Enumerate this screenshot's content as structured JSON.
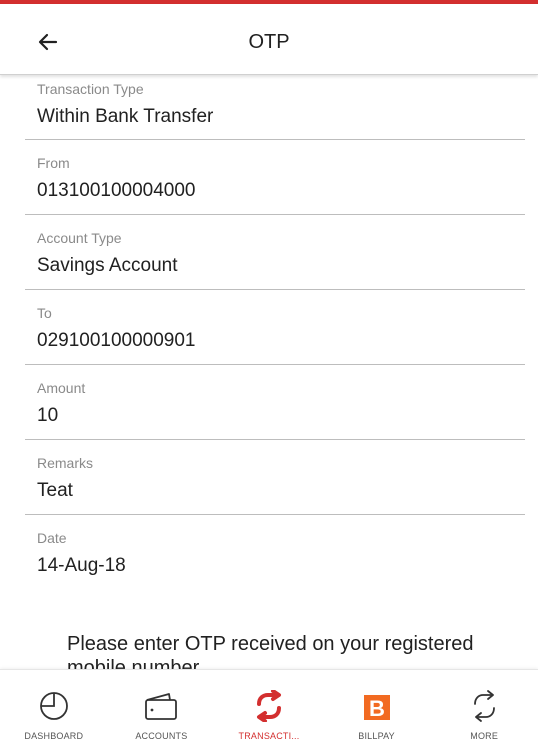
{
  "header": {
    "title": "OTP",
    "back_icon": "arrow-left-icon"
  },
  "details": [
    {
      "label": "Transaction Type",
      "value": "Within Bank Transfer"
    },
    {
      "label": "From",
      "value": "013100100004000"
    },
    {
      "label": "Account Type",
      "value": "Savings Account"
    },
    {
      "label": "To",
      "value": "029100100000901"
    },
    {
      "label": "Amount",
      "value": "10"
    },
    {
      "label": "Remarks",
      "value": "Teat"
    },
    {
      "label": "Date",
      "value": "14-Aug-18"
    }
  ],
  "otp_prompt": "Please enter OTP received on your registered mobile number",
  "bottom_nav": {
    "items": [
      {
        "label": "DASHBOARD",
        "icon": "dashboard-icon",
        "active": false
      },
      {
        "label": "ACCOUNTS",
        "icon": "wallet-icon",
        "active": false
      },
      {
        "label": "TRANSACTI...",
        "icon": "transfer-icon",
        "active": true
      },
      {
        "label": "BILLPAY",
        "icon": "billpay-icon",
        "active": false
      },
      {
        "label": "MORE",
        "icon": "more-icon",
        "active": false
      }
    ]
  },
  "colors": {
    "accent": "#d32f2f",
    "billpay_brand": "#f26a21",
    "divider": "#bdbdbd",
    "label_grey": "#8a8a8a"
  }
}
